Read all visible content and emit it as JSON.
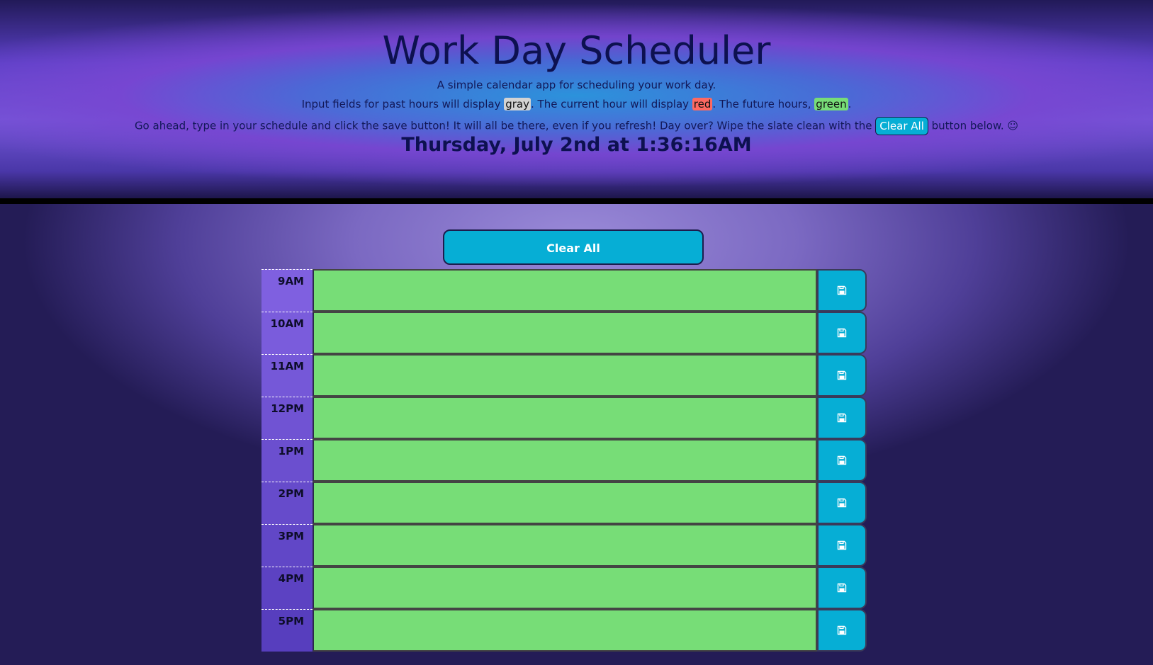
{
  "header": {
    "title": "Work Day Scheduler",
    "lead1": "A simple calendar app for scheduling your work day.",
    "lead2_a": "Input fields for past hours will display ",
    "lead2_gray": "gray",
    "lead2_b": ". The current hour will display ",
    "lead2_red": "red",
    "lead2_c": ". The future hours, ",
    "lead2_green": "green",
    "lead2_d": ".",
    "lead3_a": "Go ahead, type in your schedule and click the save button! It will all be there, even if you refresh! Day over? Wipe the slate clean with the ",
    "lead3_button": "Clear All",
    "lead3_b": " button below. ☺",
    "datetime": "Thursday, July 2nd at 1:36:16AM"
  },
  "main": {
    "clear_all_label": "Clear All",
    "save_icon": "floppy-disk-icon",
    "hours": [
      {
        "label": "9AM",
        "value": "",
        "status": "future"
      },
      {
        "label": "10AM",
        "value": "",
        "status": "future"
      },
      {
        "label": "11AM",
        "value": "",
        "status": "future"
      },
      {
        "label": "12PM",
        "value": "",
        "status": "future"
      },
      {
        "label": "1PM",
        "value": "",
        "status": "future"
      },
      {
        "label": "2PM",
        "value": "",
        "status": "future"
      },
      {
        "label": "3PM",
        "value": "",
        "status": "future"
      },
      {
        "label": "4PM",
        "value": "",
        "status": "future"
      },
      {
        "label": "5PM",
        "value": "",
        "status": "future"
      }
    ]
  },
  "colors": {
    "past": "#d3d3d3",
    "present": "#ff6961",
    "future": "#77dd77",
    "button": "#06aed5",
    "hour_column": "#7f60e0"
  }
}
